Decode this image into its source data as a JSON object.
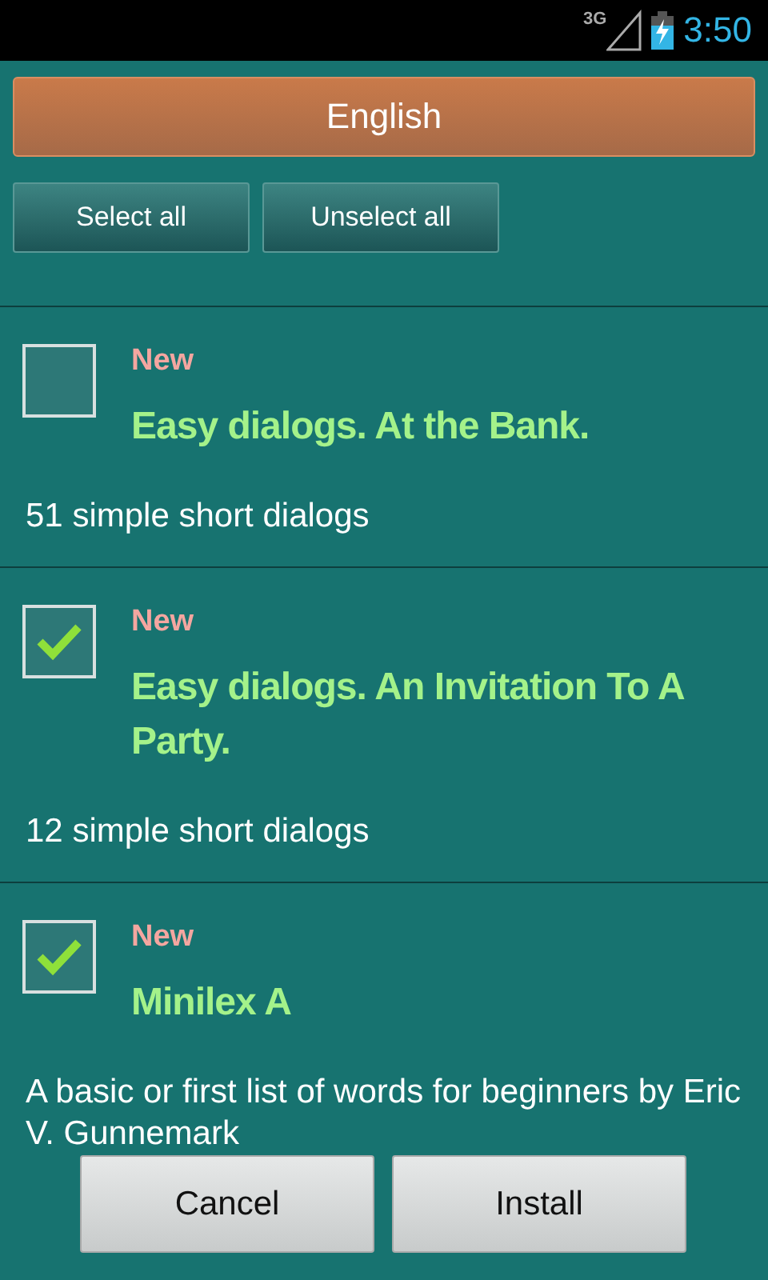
{
  "status_bar": {
    "network": "3G",
    "time": "3:50"
  },
  "header": {
    "title": "English"
  },
  "actions": [
    {
      "label": "Select all"
    },
    {
      "label": "Unselect all"
    }
  ],
  "items": [
    {
      "badge": "New",
      "title": "Easy dialogs. At the Bank.",
      "description": "51 simple short dialogs",
      "checked": false
    },
    {
      "badge": "New",
      "title": "Easy dialogs. An Invitation To A Party.",
      "description": "12 simple short dialogs",
      "checked": true
    },
    {
      "badge": "New",
      "title": "Minilex A",
      "description": "A basic or first list of words for beginners by Eric V. Gunnemark",
      "checked": true
    }
  ],
  "buttons": [
    {
      "label": "Cancel"
    },
    {
      "label": "Install"
    }
  ]
}
